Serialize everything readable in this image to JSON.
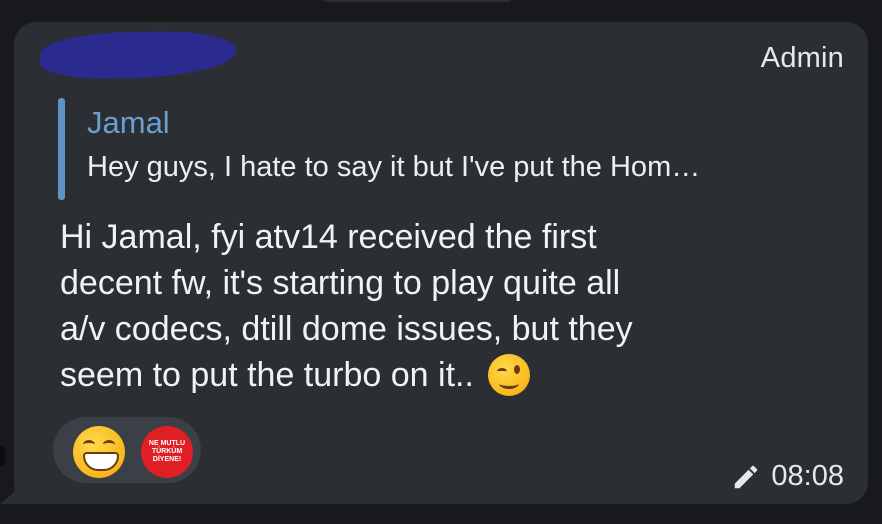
{
  "header": {
    "sender_name_redacted": "",
    "role_label": "Admin"
  },
  "reply": {
    "author": "Jamal",
    "snippet": "Hey guys,  I hate to say it but I've put the Hom…"
  },
  "message": {
    "lines": [
      "Hi Jamal, fyi atv14 received the first",
      "decent fw, it's starting to play quite all",
      "a/v codecs, dtill dome issues, but they",
      "seem to put the turbo on it.."
    ],
    "trailing_emoji": "wink-emoji"
  },
  "reactions": {
    "items": [
      {
        "icon": "grinning-face-emoji"
      },
      {
        "icon": "turkish-sticker",
        "lines": [
          "NE MUTLU",
          "TÜRKÜM",
          "DİYENE!"
        ]
      }
    ]
  },
  "meta": {
    "edited_icon": "pencil-icon",
    "time": "08:08"
  },
  "colors": {
    "background": "#17191c",
    "bubble": "#2b2f34",
    "reply_accent": "#5e93c2",
    "redaction": "#2a2a8f",
    "sticker_red": "#e01f25"
  }
}
